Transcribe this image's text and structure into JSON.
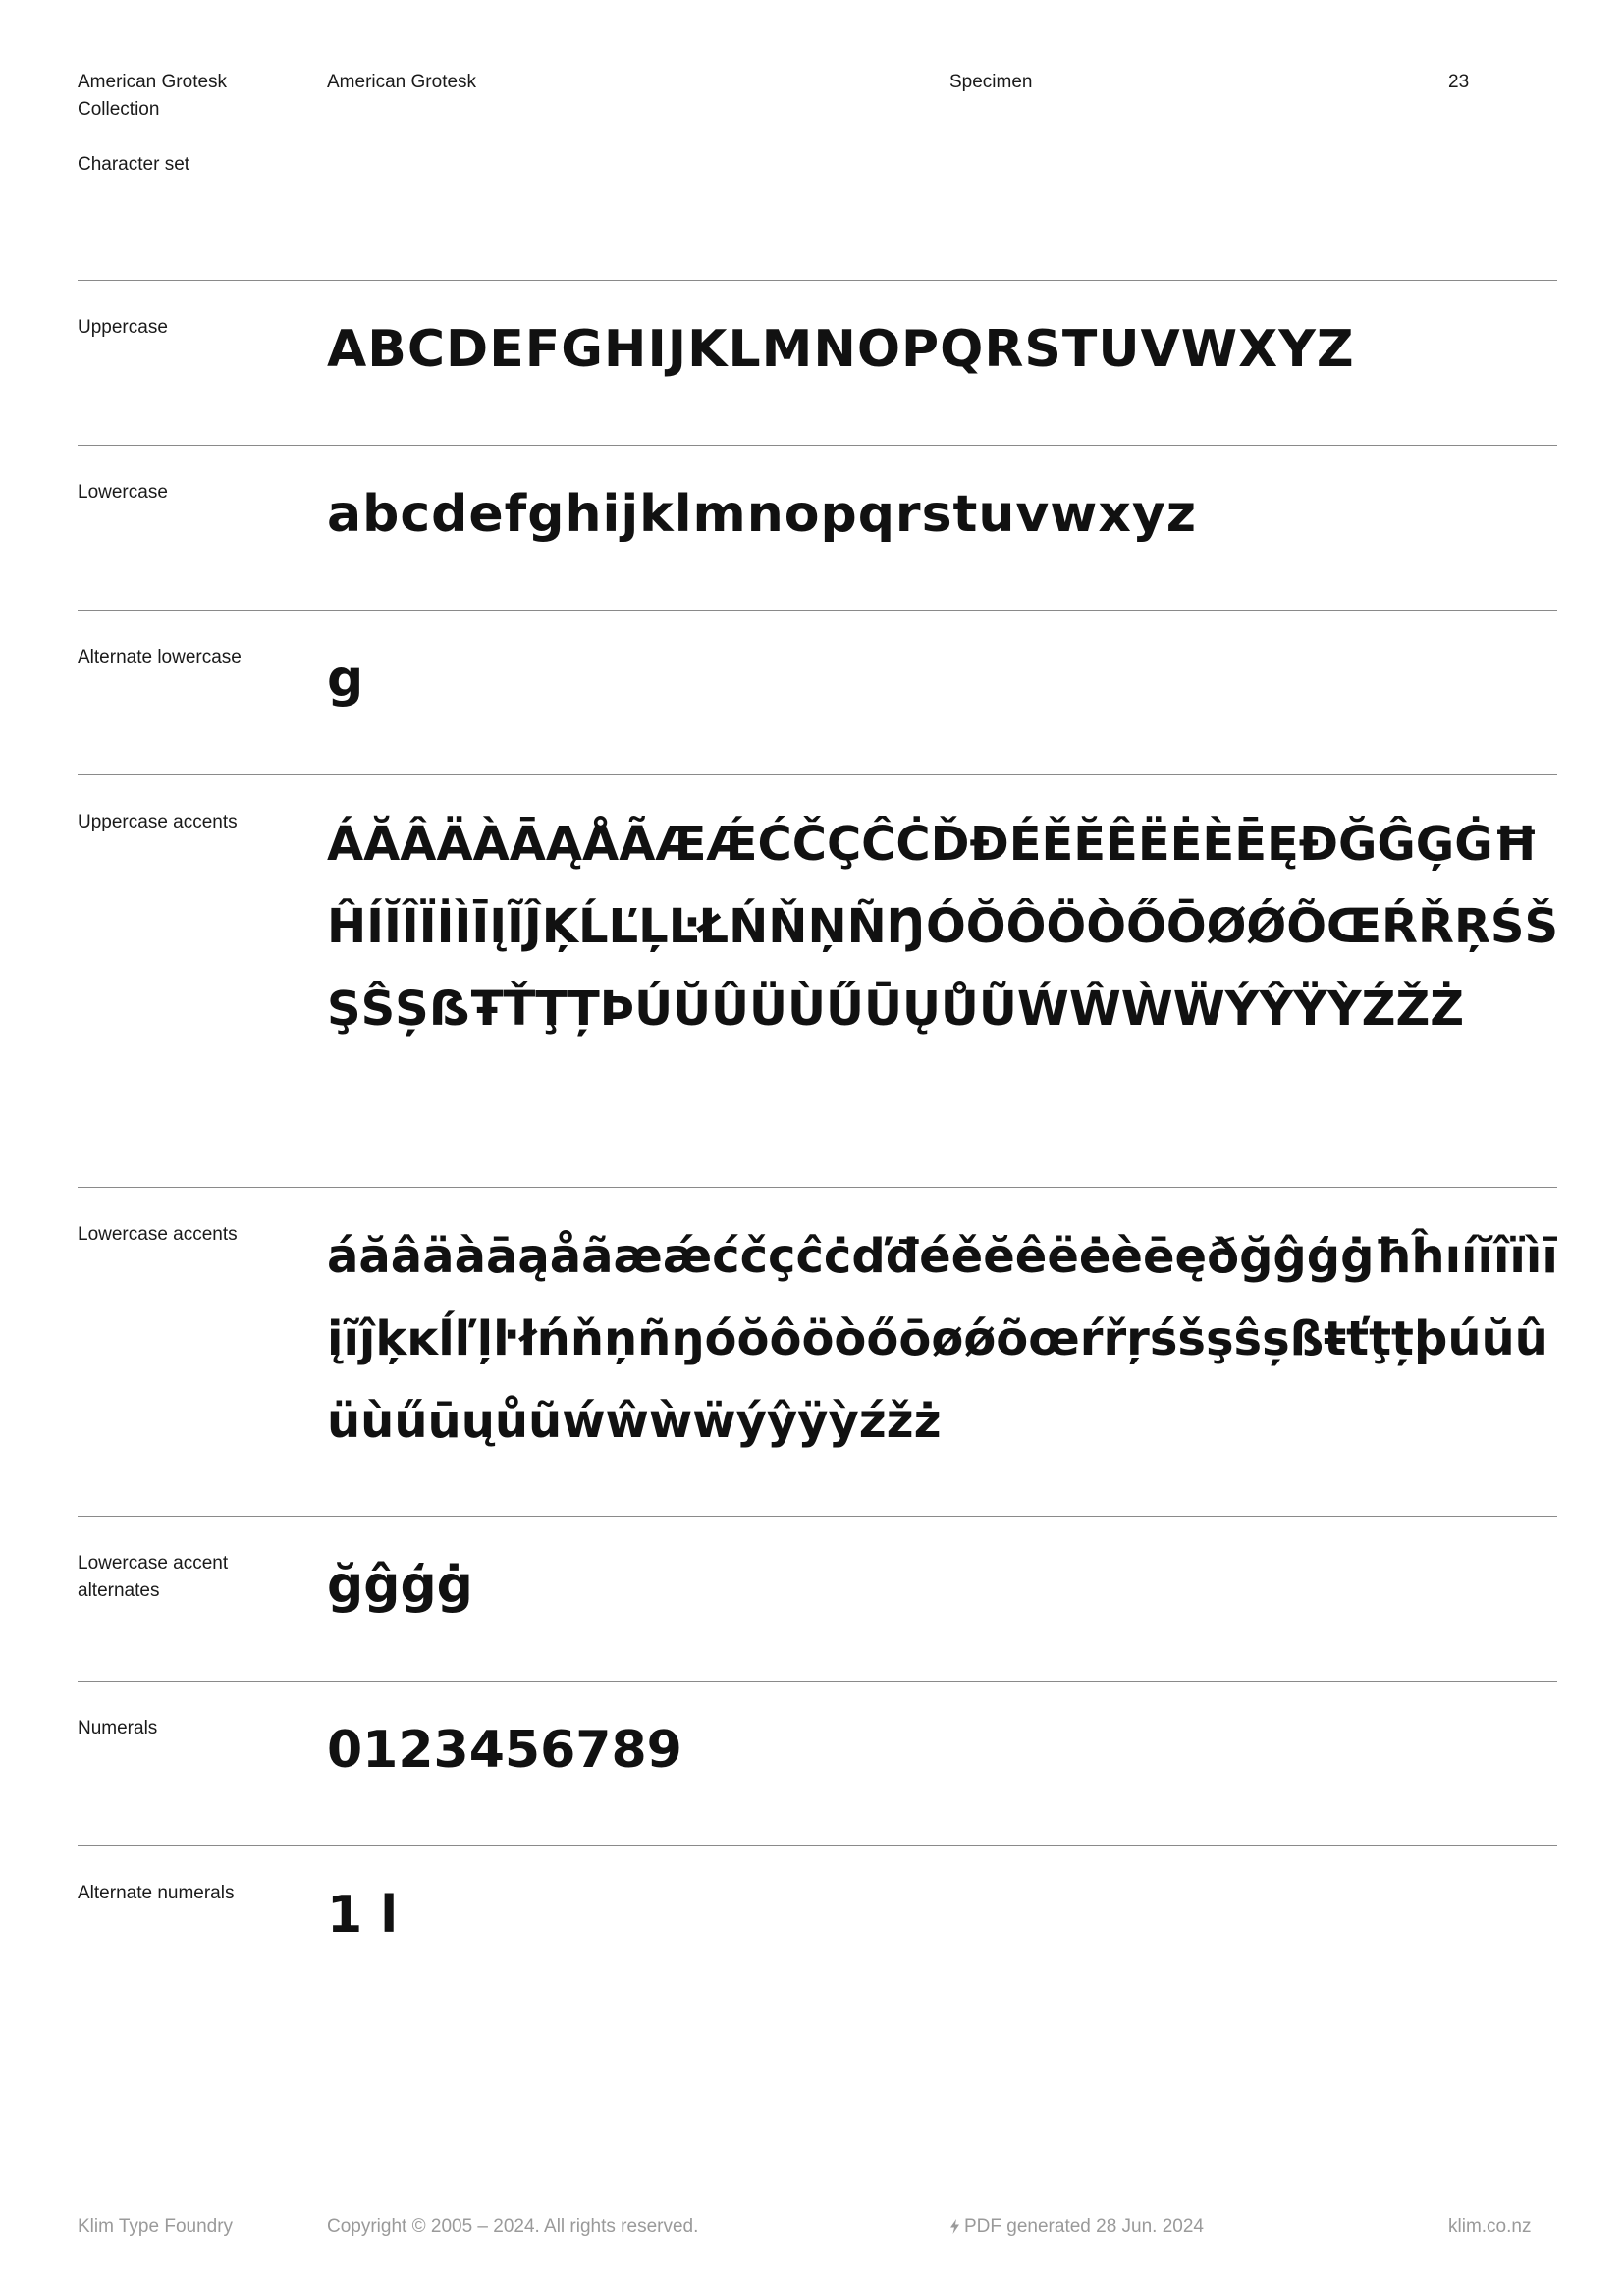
{
  "header": {
    "collection": "American Grotesk Collection",
    "section": "Character set",
    "family": "American Grotesk",
    "specimen": "Specimen",
    "page_number": "23"
  },
  "rows": [
    {
      "label": "Uppercase",
      "glyphs": "ABCDEFGHIJKLMNOPQRSTUVWXYZ"
    },
    {
      "label": "Lowercase",
      "glyphs": "abcdefghijklmnopqrstuvwxyz"
    },
    {
      "label": "Alternate lowercase",
      "glyphs": "g"
    },
    {
      "label": "Uppercase accents",
      "glyphs": "ÁĂÂÄÀĀĄÅÃÆǼĆČÇĈĊĎĐÉĚĔÊËĖÈĒĘÐĞĜĢĠĦĤÍĬÎÏİÌĪĮĨĴĶĹĽĻĿŁŃŇŅÑŊÓŎÔÖÒŐŌØǾÕŒŔŘŖŚŠŞŜȘẞŦŤŢȚÞÚŬÛÜÙŰŪŲŮŨẂŴẀẄÝŶŸỲŹŽŻ"
    },
    {
      "label": "Lowercase accents",
      "glyphs": "áăâäàāąåãæǽćčçĉċďđéěĕêëėèēęðğĝģġħĥıíĭîïìīįĩĵķĸĺľļŀłńňņñŋóŏôöòőōøǿõœŕřŗśšşŝșßŧťţțþúŭûüùűūųůũẃŵẁẅýŷÿỳźžż"
    },
    {
      "label": "Lowercase accent alternates",
      "glyphs": "ğĝģġ"
    },
    {
      "label": "Numerals",
      "glyphs": "0123456789"
    },
    {
      "label": "Alternate numerals",
      "glyphs": "1 l"
    }
  ],
  "footer": {
    "foundry": "Klim Type Foundry",
    "copyright": "Copyright © 2005 – 2024. All rights reserved.",
    "generated_icon": "lightning-bolt-icon",
    "generated": "PDF generated 28 Jun. 2024",
    "site": "klim.co.nz"
  }
}
